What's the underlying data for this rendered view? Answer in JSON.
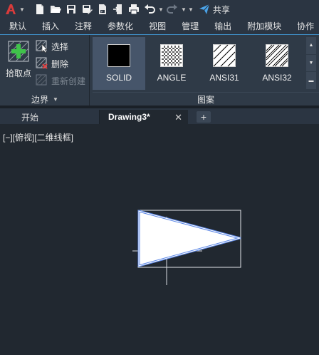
{
  "quick_access": {
    "share_label": "共享",
    "icons": [
      "app-logo-icon",
      "new-file-icon",
      "open-file-icon",
      "save-icon",
      "save-as-icon",
      "import-icon",
      "export-icon",
      "print-icon",
      "undo-icon",
      "redo-icon",
      "share-icon"
    ]
  },
  "ribbon_tabs": [
    "默认",
    "插入",
    "注释",
    "参数化",
    "视图",
    "管理",
    "输出",
    "附加模块",
    "协作"
  ],
  "ribbon": {
    "boundary_panel": {
      "pick_point_label": "拾取点",
      "select_label": "选择",
      "delete_label": "删除",
      "recreate_label": "重新创建",
      "title": "边界"
    },
    "pattern_panel": {
      "title": "图案",
      "items": [
        {
          "label": "SOLID",
          "selected": true
        },
        {
          "label": "ANGLE",
          "selected": false
        },
        {
          "label": "ANSI31",
          "selected": false
        },
        {
          "label": "ANSI32",
          "selected": false
        }
      ]
    }
  },
  "file_tabs": {
    "start": "开始",
    "active": "Drawing3*",
    "close_glyph": "✕",
    "new_glyph": "+"
  },
  "viewport": {
    "label": "[−][俯视][二维线框]"
  },
  "colors": {
    "background": "#212830",
    "ribbon": "#2f3a47",
    "accent": "#3f8fc8",
    "hatch_fill": "#ffffff",
    "selection_outline": "#5a86e6",
    "logo": "#d83b3b",
    "pick_plus": "#3fc34a"
  }
}
